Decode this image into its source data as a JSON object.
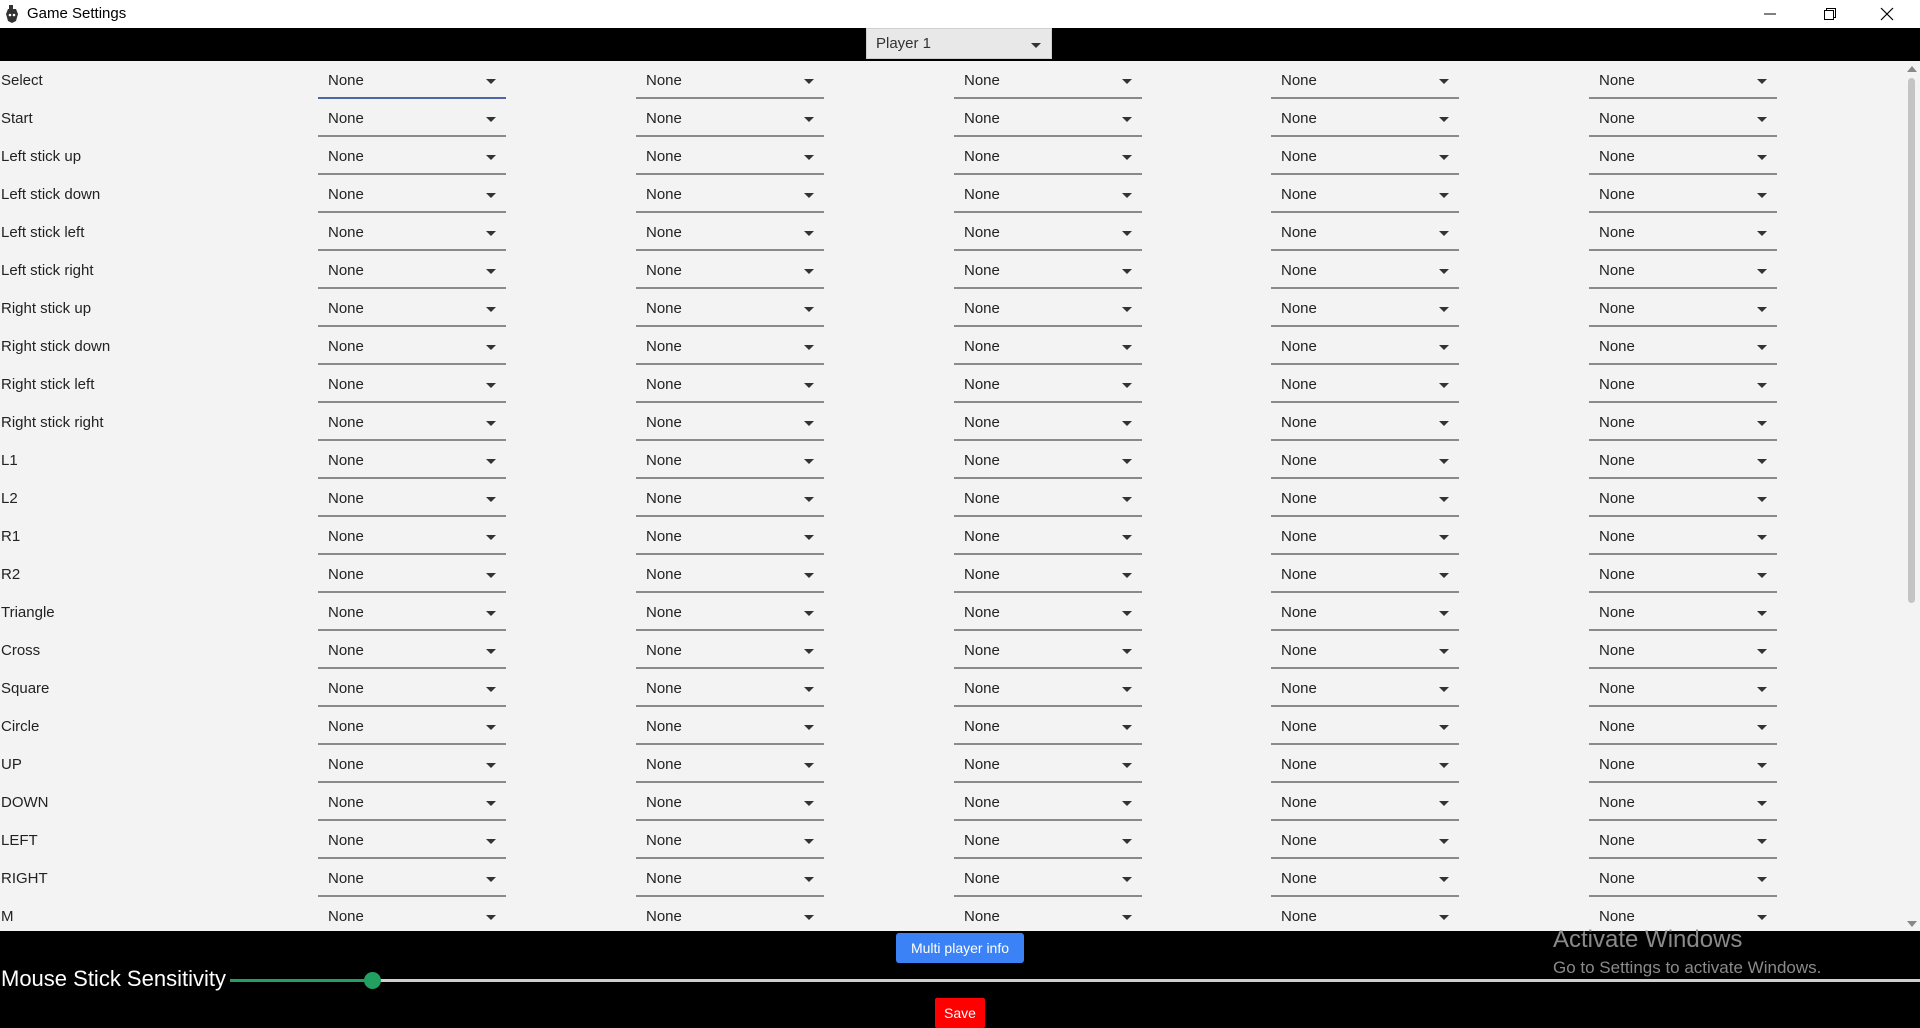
{
  "window": {
    "title": "Game Settings",
    "icons": [
      "app-gamepad-icon",
      "minimize-icon",
      "restore-icon",
      "close-icon"
    ]
  },
  "player_select": {
    "value": "Player 1"
  },
  "bindings": {
    "rows": [
      {
        "label": "Select",
        "values": [
          "None",
          "None",
          "None",
          "None",
          "None"
        ]
      },
      {
        "label": "Start",
        "values": [
          "None",
          "None",
          "None",
          "None",
          "None"
        ]
      },
      {
        "label": "Left stick up",
        "values": [
          "None",
          "None",
          "None",
          "None",
          "None"
        ]
      },
      {
        "label": "Left stick down",
        "values": [
          "None",
          "None",
          "None",
          "None",
          "None"
        ]
      },
      {
        "label": "Left stick left",
        "values": [
          "None",
          "None",
          "None",
          "None",
          "None"
        ]
      },
      {
        "label": "Left stick right",
        "values": [
          "None",
          "None",
          "None",
          "None",
          "None"
        ]
      },
      {
        "label": "Right stick up",
        "values": [
          "None",
          "None",
          "None",
          "None",
          "None"
        ]
      },
      {
        "label": "Right stick down",
        "values": [
          "None",
          "None",
          "None",
          "None",
          "None"
        ]
      },
      {
        "label": "Right stick left",
        "values": [
          "None",
          "None",
          "None",
          "None",
          "None"
        ]
      },
      {
        "label": "Right stick right",
        "values": [
          "None",
          "None",
          "None",
          "None",
          "None"
        ]
      },
      {
        "label": "L1",
        "values": [
          "None",
          "None",
          "None",
          "None",
          "None"
        ]
      },
      {
        "label": "L2",
        "values": [
          "None",
          "None",
          "None",
          "None",
          "None"
        ]
      },
      {
        "label": "R1",
        "values": [
          "None",
          "None",
          "None",
          "None",
          "None"
        ]
      },
      {
        "label": "R2",
        "values": [
          "None",
          "None",
          "None",
          "None",
          "None"
        ]
      },
      {
        "label": "Triangle",
        "values": [
          "None",
          "None",
          "None",
          "None",
          "None"
        ]
      },
      {
        "label": "Cross",
        "values": [
          "None",
          "None",
          "None",
          "None",
          "None"
        ]
      },
      {
        "label": "Square",
        "values": [
          "None",
          "None",
          "None",
          "None",
          "None"
        ]
      },
      {
        "label": "Circle",
        "values": [
          "None",
          "None",
          "None",
          "None",
          "None"
        ]
      },
      {
        "label": "UP",
        "values": [
          "None",
          "None",
          "None",
          "None",
          "None"
        ]
      },
      {
        "label": "DOWN",
        "values": [
          "None",
          "None",
          "None",
          "None",
          "None"
        ]
      },
      {
        "label": "LEFT",
        "values": [
          "None",
          "None",
          "None",
          "None",
          "None"
        ]
      },
      {
        "label": "RIGHT",
        "values": [
          "None",
          "None",
          "None",
          "None",
          "None"
        ]
      },
      {
        "label": "M",
        "values": [
          "None",
          "None",
          "None",
          "None",
          "None"
        ]
      }
    ]
  },
  "footer": {
    "multi_player_button": "Multi player info",
    "sensitivity_label": "Mouse Stick Sensitivity",
    "sensitivity_value_fraction": 0.084,
    "save_button": "Save"
  },
  "watermark": {
    "line1": "Activate Windows",
    "line2": "Go to Settings to activate Windows."
  },
  "colors": {
    "accent_blue": "#3b82f6",
    "save_red": "#ff0000",
    "slider_green": "#22a060",
    "active_underline": "#4e67a6"
  }
}
